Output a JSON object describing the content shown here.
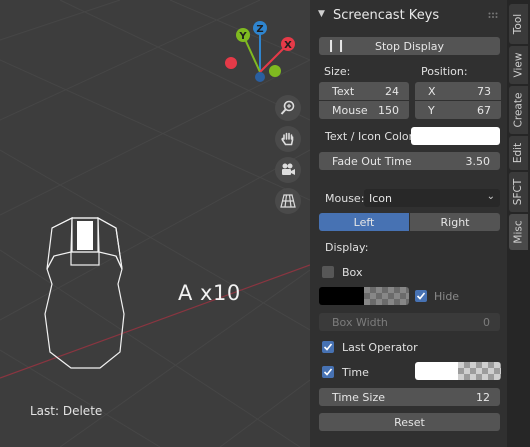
{
  "viewport": {
    "overlay_keys": "A x10",
    "last_operator": "Last: Delete",
    "gizmo": {
      "y_label": "Y",
      "z_label": "Z",
      "x_label": "X"
    },
    "nav_icons": [
      "zoom-icon",
      "pan-hand-icon",
      "camera-icon",
      "grid-perspective-icon"
    ]
  },
  "panel": {
    "title": "Screencast Keys",
    "stop_display_label": "Stop Display",
    "size_label": "Size:",
    "position_label": "Position:",
    "text_label": "Text",
    "text_value": "24",
    "mouse_label": "Mouse",
    "mouse_value": "150",
    "x_label": "X",
    "x_value": "73",
    "y_label": "Y",
    "y_value": "67",
    "text_icon_color_label": "Text / Icon Color:",
    "text_icon_color": "#ffffff",
    "fade_out_label": "Fade Out Time",
    "fade_out_value": "3.50",
    "mouse_mode_label": "Mouse:",
    "mouse_mode_value": "Icon",
    "left_label": "Left",
    "right_label": "Right",
    "display_label": "Display:",
    "box_label": "Box",
    "box_checked": false,
    "hide_label": "Hide",
    "hide_checked": true,
    "box_width_label": "Box Width",
    "box_width_value": "0",
    "last_operator_label": "Last Operator",
    "last_operator_checked": true,
    "time_label": "Time",
    "time_checked": true,
    "time_size_label": "Time Size",
    "time_size_value": "12",
    "reset_label": "Reset"
  },
  "tabs": [
    "Tool",
    "View",
    "Create",
    "Edit",
    "SFCT",
    "Misc"
  ],
  "active_tab": "Misc",
  "colors": {
    "accent": "#4772b3",
    "axis_x": "#e53a48",
    "axis_y": "#7fba20",
    "axis_z": "#2f85cf",
    "panel_bg": "#303030",
    "viewport_bg": "#3d3d3d"
  }
}
